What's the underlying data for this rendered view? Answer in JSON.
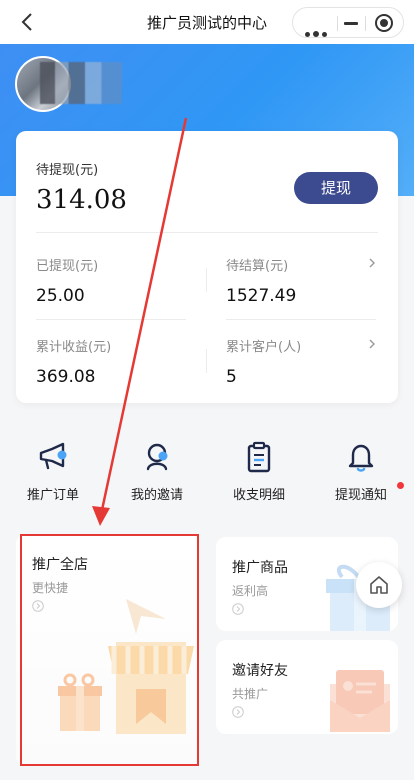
{
  "titlebar": {
    "title": "推广员测试的中心"
  },
  "wallet": {
    "pending_label": "待提现(元)",
    "pending_value": "314.08",
    "withdraw_button": "提现",
    "stats": [
      {
        "label": "已提现(元)",
        "value": "25.00"
      },
      {
        "label": "待结算(元)",
        "value": "1527.49"
      },
      {
        "label": "累计收益(元)",
        "value": "369.08"
      },
      {
        "label": "累计客户(人)",
        "value": "5"
      }
    ]
  },
  "quick_entries": [
    {
      "label": "推广订单",
      "icon": "megaphone-icon"
    },
    {
      "label": "我的邀请",
      "icon": "user-icon"
    },
    {
      "label": "收支明细",
      "icon": "clipboard-icon"
    },
    {
      "label": "提现通知",
      "icon": "bell-icon"
    }
  ],
  "tiles": [
    {
      "title": "推广全店",
      "subtitle": "更快捷"
    },
    {
      "title": "推广商品",
      "subtitle": "返利高"
    },
    {
      "title": "邀请好友",
      "subtitle": "共推广"
    }
  ],
  "colors": {
    "header_blue": "#3f8ff3",
    "withdraw_button": "#3c4a8f",
    "annotation_red": "#e53935",
    "notification_dot": "#f0383a"
  }
}
